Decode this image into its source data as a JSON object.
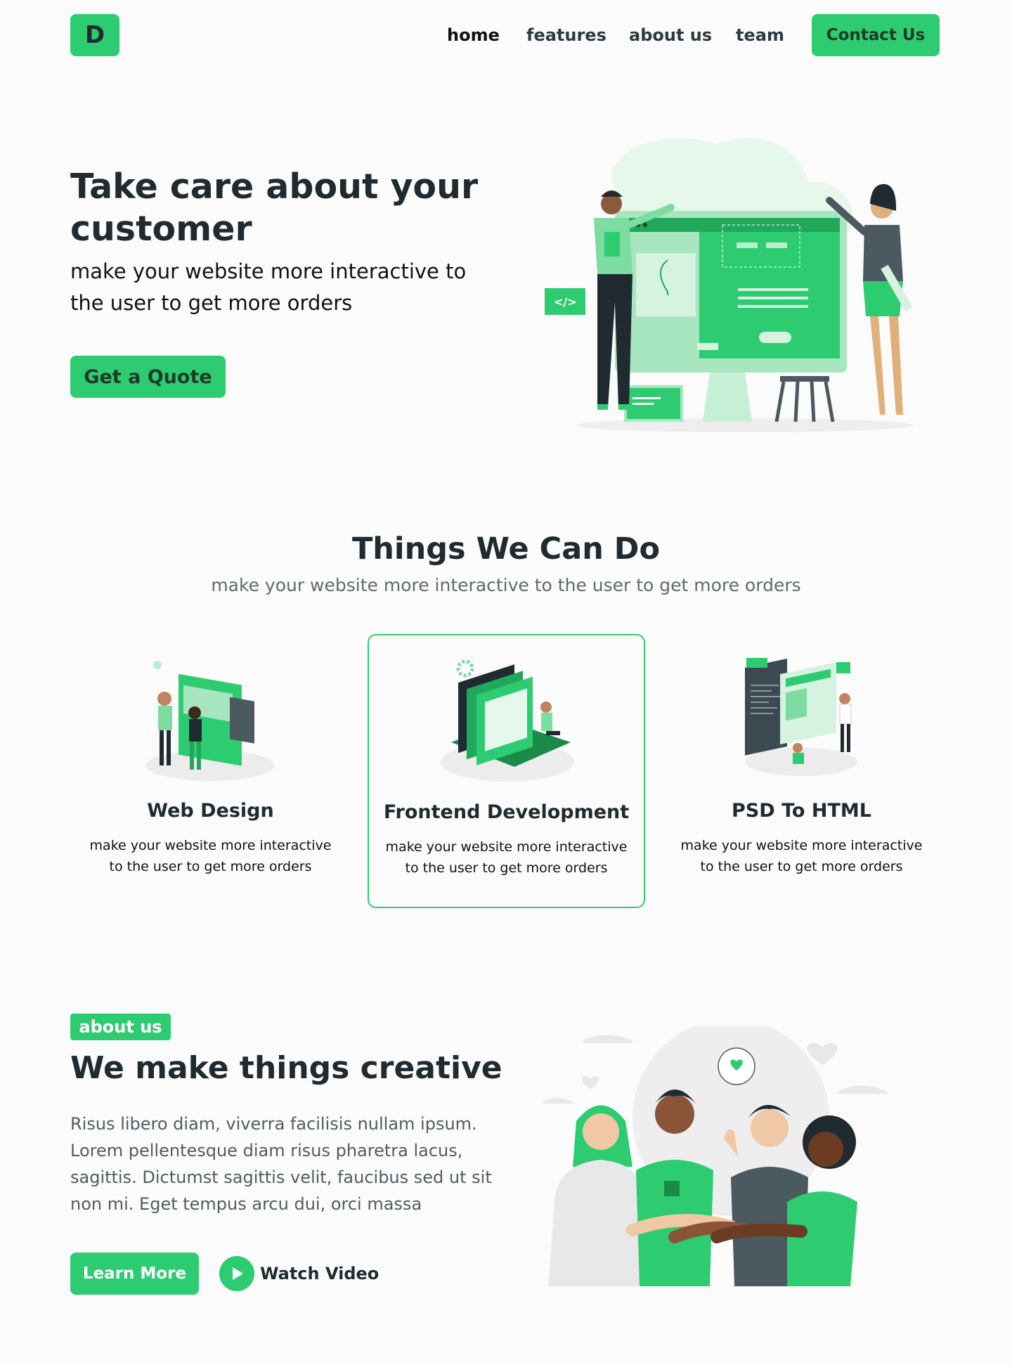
{
  "nav": {
    "logo": "D",
    "links": [
      "home",
      "features",
      "about us",
      "team"
    ],
    "cta": "Contact Us"
  },
  "hero": {
    "title": "Take care about your customer",
    "subtitle": "make your website more interactive to the user to get more orders",
    "button": "Get a Quote",
    "code_tag": "</>"
  },
  "services": {
    "title": "Things We Can Do",
    "subtitle": "make your website more interactive to the user to get more orders",
    "cards": [
      {
        "title": "Web Design",
        "text": "make your website more interactive to the user to get more orders",
        "icon": "web-design-illustration",
        "featured": false
      },
      {
        "title": "Frontend Development",
        "text": "make your website more interactive to the user to get more orders",
        "icon": "frontend-illustration",
        "featured": true
      },
      {
        "title": "PSD To HTML",
        "text": "make your website more interactive to the user to get more orders",
        "icon": "psd-to-html-illustration",
        "featured": false
      }
    ]
  },
  "about": {
    "tag": "about us",
    "title": "We make things creative",
    "text": "Risus libero diam, viverra facilisis nullam ipsum. Lorem pellentesque diam risus pharetra lacus, sagittis. Dictumst sagittis velit, faucibus sed ut sit non mi. Eget tempus arcu dui, orci massa",
    "learn_more": "Learn More",
    "watch_video": "Watch Video"
  },
  "colors": {
    "accent": "#2ecc71",
    "dark": "#1f2b30",
    "muted": "#5d6b70",
    "background": "#fbfbfb"
  }
}
